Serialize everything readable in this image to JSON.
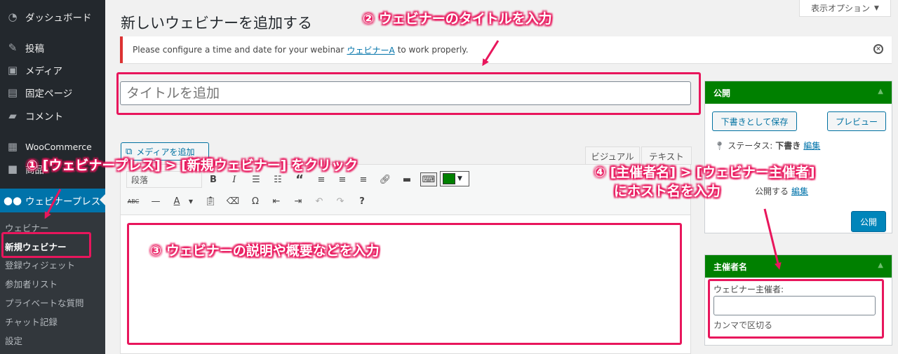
{
  "sidebar": {
    "items": [
      {
        "label": "ダッシュボード",
        "icon": "dashboard-icon"
      },
      {
        "label": "投稿",
        "icon": "pin-icon"
      },
      {
        "label": "メディア",
        "icon": "media-icon"
      },
      {
        "label": "固定ページ",
        "icon": "page-icon"
      },
      {
        "label": "コメント",
        "icon": "comment-icon"
      },
      {
        "label": "WooCommerce",
        "icon": "woo-icon"
      },
      {
        "label": "商品",
        "icon": "box-icon"
      },
      {
        "label": "ウェビナープレス",
        "icon": "users-icon"
      }
    ],
    "submenu": [
      "ウェビナー",
      "新規ウェビナー",
      "登録ウィジェット",
      "参加者リスト",
      "プライベートな質問",
      "チャット記録",
      "設定"
    ],
    "active_color": "#0073aa"
  },
  "page": {
    "title": "新しいウェビナーを追加する",
    "screen_options": "表示オプション"
  },
  "notice": {
    "before": "Please configure a time and date for your webinar",
    "link": "ウェビナーA",
    "after": "to work properly."
  },
  "title_field": {
    "placeholder": "タイトルを追加"
  },
  "editor": {
    "add_media": "メディアを追加",
    "tabs": [
      "ビジュアル",
      "テキスト"
    ],
    "format": "段落",
    "swatch_color": "#008000"
  },
  "publish": {
    "heading": "公開",
    "save_draft": "下書きとして保存",
    "preview": "プレビュー",
    "status_label": "ステータス:",
    "status_value": "下書き",
    "edit": "編集",
    "publish_immediately": "公開する",
    "publish_edit": "編集",
    "publish_button": "公開",
    "header_color": "#008000"
  },
  "organizer": {
    "heading": "主催者名",
    "label": "ウェビナー主催者:",
    "hint": "カンマで区切る"
  },
  "annotations": {
    "step1": "① [ウェビナープレス] > [新規ウェビナー] をクリック",
    "step2": "② ウェビナーのタイトルを入力",
    "step3": "③ ウェビナーの説明や概要などを入力",
    "step4_line1": "④ [主催者名] > [ウェビナー主催者]",
    "step4_line2": "にホスト名を入力",
    "color": "#e8165c"
  }
}
